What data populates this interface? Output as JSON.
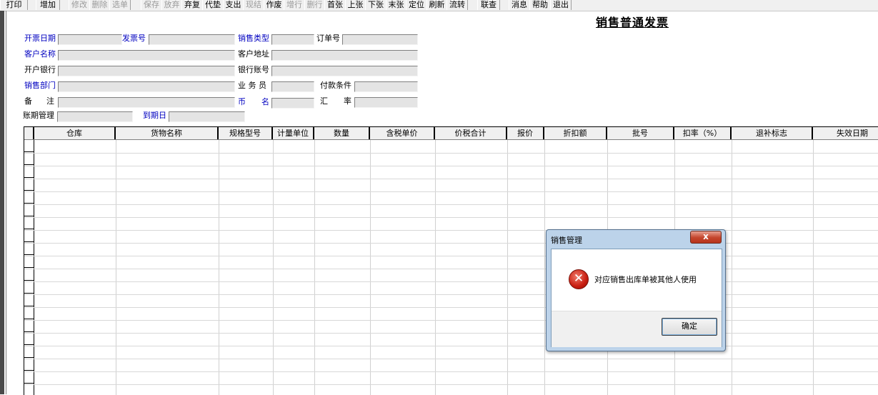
{
  "toolbar": {
    "buttons": [
      {
        "label": "打印",
        "enabled": true
      },
      {
        "label": "增加",
        "enabled": true
      },
      {
        "label": "修改",
        "enabled": false
      },
      {
        "label": "删除",
        "enabled": false
      },
      {
        "label": "选单",
        "enabled": false
      },
      {
        "label": "保存",
        "enabled": false
      },
      {
        "label": "放弃",
        "enabled": false
      },
      {
        "label": "弃复",
        "enabled": true
      },
      {
        "label": "代垫",
        "enabled": true
      },
      {
        "label": "支出",
        "enabled": true
      },
      {
        "label": "现结",
        "enabled": false
      },
      {
        "label": "作废",
        "enabled": true
      },
      {
        "label": "增行",
        "enabled": false
      },
      {
        "label": "删行",
        "enabled": false
      },
      {
        "label": "首张",
        "enabled": true
      },
      {
        "label": "上张",
        "enabled": true
      },
      {
        "label": "下张",
        "enabled": true
      },
      {
        "label": "末张",
        "enabled": true
      },
      {
        "label": "定位",
        "enabled": true
      },
      {
        "label": "刷新",
        "enabled": true
      },
      {
        "label": "流转",
        "enabled": true
      },
      {
        "label": "联查",
        "enabled": true
      },
      {
        "label": "消息",
        "enabled": true
      },
      {
        "label": "帮助",
        "enabled": true
      },
      {
        "label": "退出",
        "enabled": true
      }
    ]
  },
  "page_title": "销售普通发票",
  "form": {
    "invoice_date": "开票日期",
    "invoice_no": "发票号",
    "sales_type": "销售类型",
    "order_no": "订单号",
    "customer_name": "客户名称",
    "customer_address": "客户地址",
    "bank": "开户银行",
    "bank_account": "银行账号",
    "sales_dept": "销售部门",
    "salesperson": "业 务 员",
    "payment_terms": "付款条件",
    "remarks_1": "备",
    "remarks_2": "注",
    "currency_1": "币",
    "currency_2": "名",
    "rate_1": "汇",
    "rate_2": "率",
    "period_mgmt": "账期管理",
    "due_date": "到期日"
  },
  "grid": {
    "columns": [
      "仓库",
      "货物名称",
      "规格型号",
      "计量单位",
      "数量",
      "含税单价",
      "价税合计",
      "报价",
      "折扣额",
      "批号",
      "扣率（%）",
      "退补标志",
      "失效日期"
    ]
  },
  "dialog": {
    "title": "销售管理",
    "close": "x",
    "message": "对应销售出库单被其他人使用",
    "ok": "确定",
    "icon": "error-icon"
  }
}
